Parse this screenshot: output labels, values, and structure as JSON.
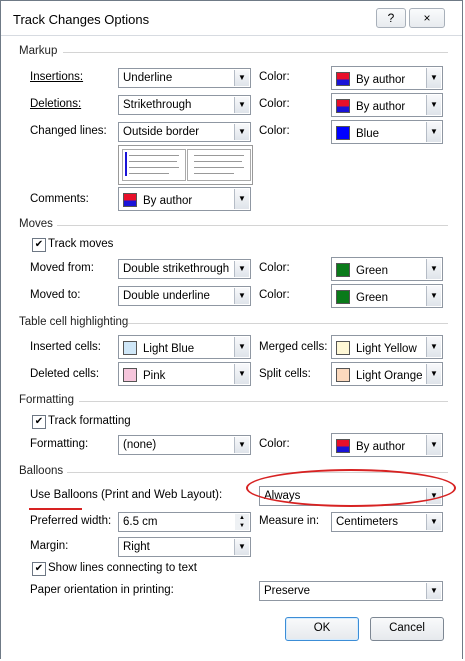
{
  "window": {
    "title": "Track Changes Options",
    "help_label": "?",
    "close_label": "×"
  },
  "sections": {
    "markup": "Markup",
    "moves": "Moves",
    "table": "Table cell highlighting",
    "formatting": "Formatting",
    "balloons": "Balloons"
  },
  "markup": {
    "insertions_label": "Insertions:",
    "insertions_value": "Underline",
    "insertions_color_label": "Color:",
    "insertions_color": "By author",
    "deletions_label": "Deletions:",
    "deletions_value": "Strikethrough",
    "deletions_color_label": "Color:",
    "deletions_color": "By author",
    "changed_label": "Changed lines:",
    "changed_value": "Outside border",
    "changed_color_label": "Color:",
    "changed_color": "Blue",
    "comments_label": "Comments:",
    "comments_value": "By author"
  },
  "moves": {
    "track_label": "Track moves",
    "from_label": "Moved from:",
    "from_value": "Double strikethrough",
    "from_color_label": "Color:",
    "from_color": "Green",
    "to_label": "Moved to:",
    "to_value": "Double underline",
    "to_color_label": "Color:",
    "to_color": "Green"
  },
  "table": {
    "inserted_label": "Inserted cells:",
    "inserted_value": "Light Blue",
    "merged_label": "Merged cells:",
    "merged_value": "Light Yellow",
    "deleted_label": "Deleted cells:",
    "deleted_value": "Pink",
    "split_label": "Split cells:",
    "split_value": "Light Orange"
  },
  "formatting": {
    "track_label": "Track formatting",
    "formatting_label": "Formatting:",
    "formatting_value": "(none)",
    "color_label": "Color:",
    "color_value": "By author"
  },
  "balloons": {
    "use_label": "Use Balloons (Print and Web Layout):",
    "use_value": "Always",
    "width_label": "Preferred width:",
    "width_value": "6.5 cm",
    "measure_label": "Measure in:",
    "measure_value": "Centimeters",
    "margin_label": "Margin:",
    "margin_value": "Right",
    "show_lines_label": "Show lines connecting to text",
    "paper_label": "Paper orientation in printing:",
    "paper_value": "Preserve"
  },
  "buttons": {
    "ok": "OK",
    "cancel": "Cancel"
  },
  "colors": {
    "author_top": "#e8102a",
    "author_bottom": "#1a14d8",
    "blue": "#0000ff",
    "green": "#0a7a1a",
    "light_blue": "#cfe7f8",
    "light_yellow": "#fff8d6",
    "pink": "#f6c6dc",
    "light_orange": "#fbd9be",
    "annotation_red": "#d72222"
  }
}
